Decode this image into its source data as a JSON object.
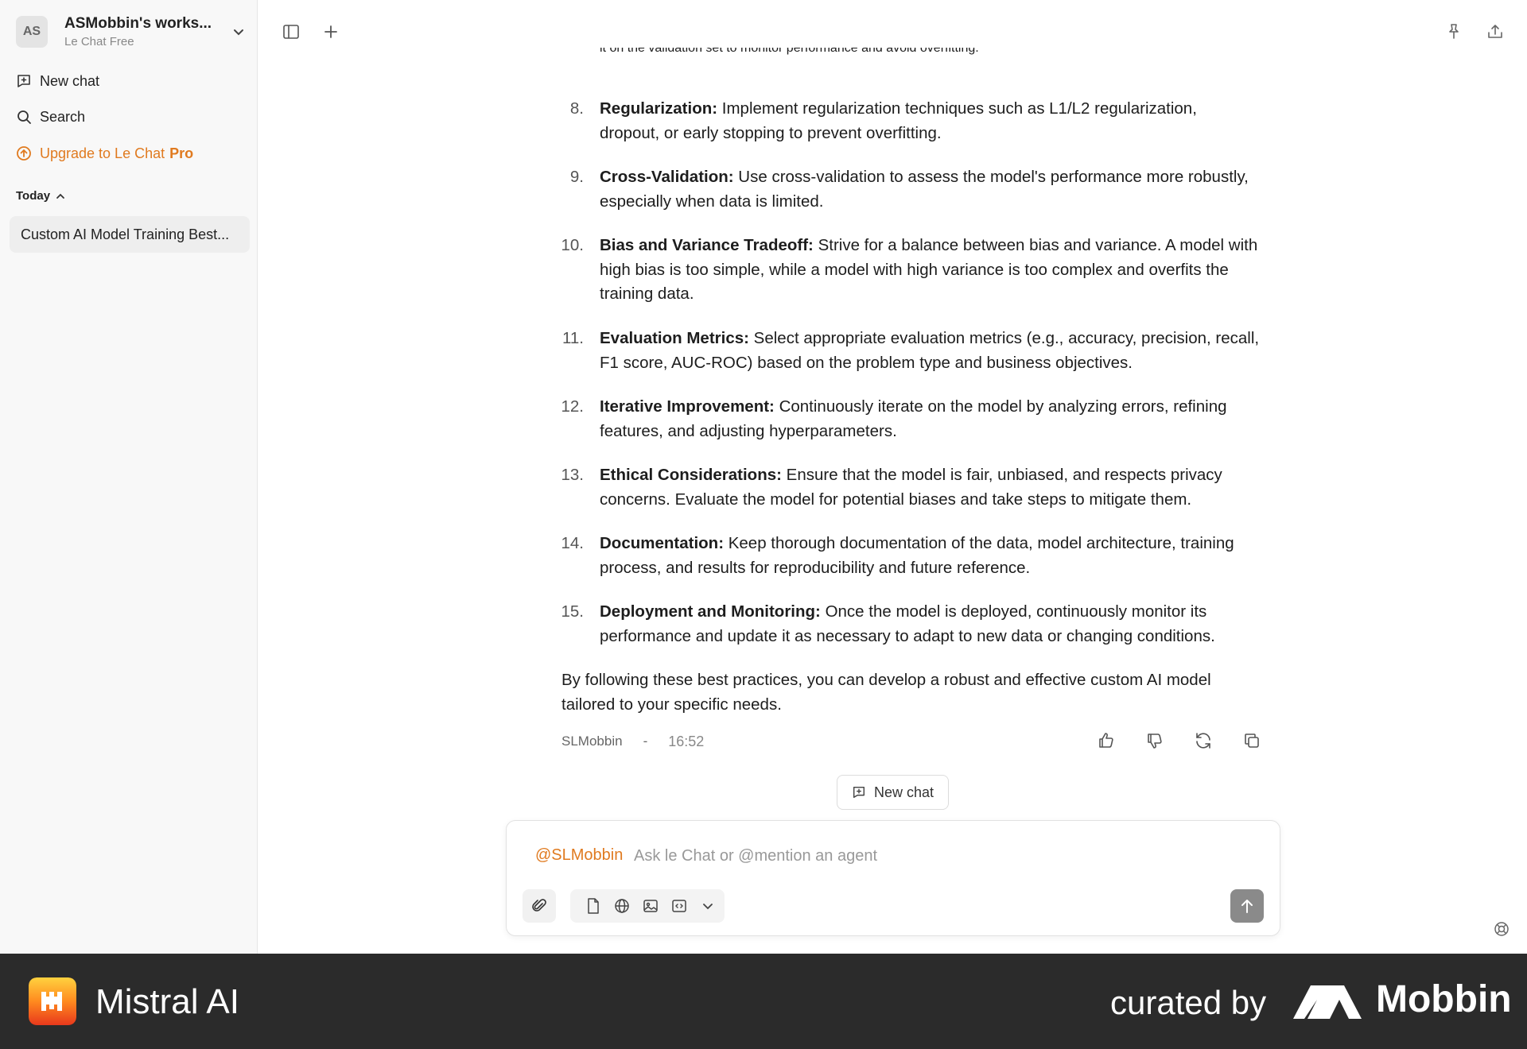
{
  "sidebar": {
    "workspace": {
      "initials": "AS",
      "name": "ASMobbin's works...",
      "plan": "Le Chat Free"
    },
    "new_chat": "New chat",
    "search": "Search",
    "upgrade_prefix": "Upgrade to Le Chat",
    "upgrade_suffix": "Pro",
    "section_today": "Today",
    "history": [
      "Custom AI Model Training Best..."
    ]
  },
  "message": {
    "clipped_line": "it on the validation set to monitor performance and avoid overfitting.",
    "items": [
      {
        "num": "8.",
        "title": "Regularization:",
        "body": "Implement regularization techniques such as L1/L2 regularization, dropout, or early stopping to prevent overfitting."
      },
      {
        "num": "9.",
        "title": "Cross-Validation:",
        "body": "Use cross-validation to assess the model's performance more robustly, especially when data is limited."
      },
      {
        "num": "10.",
        "title": "Bias and Variance Tradeoff:",
        "body": "Strive for a balance between bias and variance. A model with high bias is too simple, while a model with high variance is too complex and overfits the training data."
      },
      {
        "num": "11.",
        "title": "Evaluation Metrics:",
        "body": "Select appropriate evaluation metrics (e.g., accuracy, precision, recall, F1 score, AUC-ROC) based on the problem type and business objectives."
      },
      {
        "num": "12.",
        "title": "Iterative Improvement:",
        "body": "Continuously iterate on the model by analyzing errors, refining features, and adjusting hyperparameters."
      },
      {
        "num": "13.",
        "title": "Ethical Considerations:",
        "body": "Ensure that the model is fair, unbiased, and respects privacy concerns. Evaluate the model for potential biases and take steps to mitigate them."
      },
      {
        "num": "14.",
        "title": "Documentation:",
        "body": "Keep thorough documentation of the data, model architecture, training process, and results for reproducibility and future reference."
      },
      {
        "num": "15.",
        "title": "Deployment and Monitoring:",
        "body": "Once the model is deployed, continuously monitor its performance and update it as necessary to adapt to new data or changing conditions."
      }
    ],
    "closing": "By following these best practices, you can develop a robust and effective custom AI model tailored to your specific needs.",
    "author": "SLMobbin",
    "separator": "-",
    "time": "16:52"
  },
  "new_chat_button": "New chat",
  "composer": {
    "mention": "@SLMobbin",
    "placeholder": "Ask le Chat or @mention an agent",
    "value": ""
  },
  "footer": {
    "brand": "Mistral AI",
    "curated": "curated by",
    "mobbin": "Mobbin"
  },
  "colors": {
    "accent": "#e07a1f",
    "footer_bg": "#2b2b2b"
  }
}
